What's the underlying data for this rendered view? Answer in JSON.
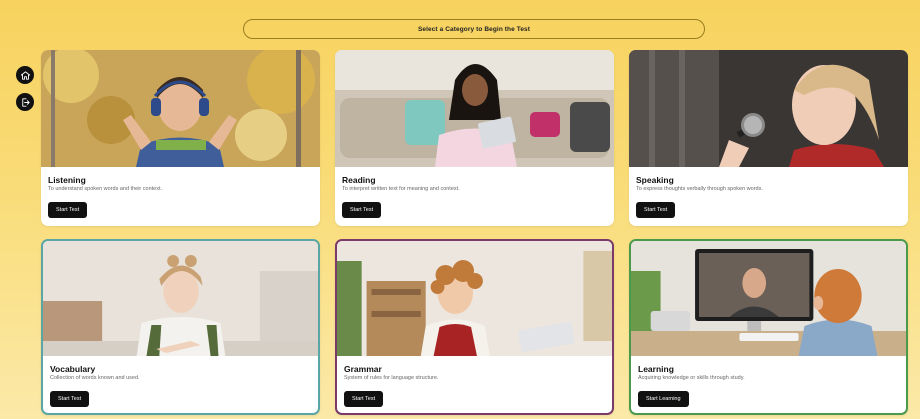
{
  "header": {
    "prompt": "Select a Category to Begin the Test"
  },
  "sidebar": {
    "home_icon": "home-icon",
    "logout_icon": "logout-icon"
  },
  "colors": {
    "background": "#f7d25e",
    "card_border_vocabulary": "#5aa6a6",
    "card_border_grammar": "#7a3a6a",
    "card_border_learning": "#4b9a4b",
    "button": "#111111"
  },
  "categories": [
    {
      "title": "Listening",
      "description": "To understand spoken words and their context.",
      "button": "Start Test"
    },
    {
      "title": "Reading",
      "description": "To interpret written text for meaning and context.",
      "button": "Start Test"
    },
    {
      "title": "Speaking",
      "description": "To express thoughts verbally through spoken words.",
      "button": "Start Test"
    },
    {
      "title": "Vocabulary",
      "description": "Collection of words known and used.",
      "button": "Start Test"
    },
    {
      "title": "Grammar",
      "description": "System of rules for language structure.",
      "button": "Start Test"
    },
    {
      "title": "Learning",
      "description": "Acquiring knowledge or skills through study.",
      "button": "Start Learning"
    }
  ]
}
